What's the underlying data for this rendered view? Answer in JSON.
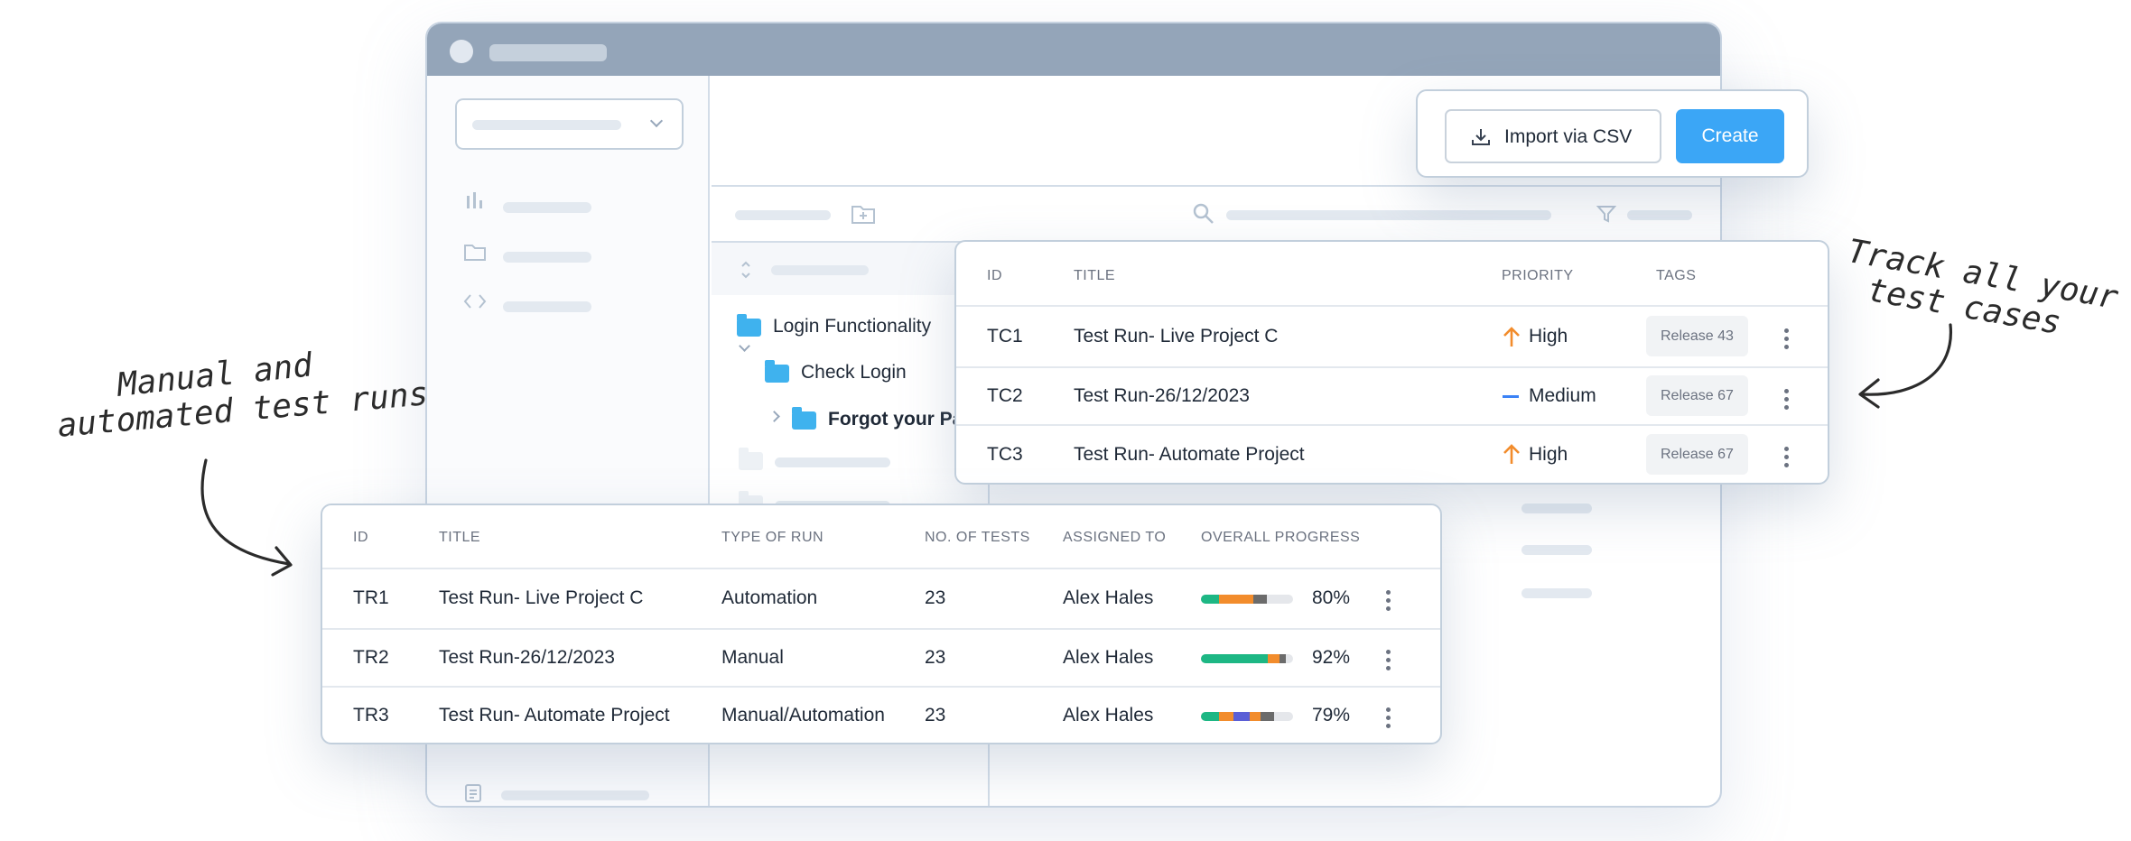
{
  "annotations": {
    "left_line1": "Manual and",
    "left_line2": "automated test runs",
    "right_line1": "Track all your",
    "right_line2": "test cases"
  },
  "folder_tree": {
    "items": [
      {
        "label": "Login Functionality",
        "icon": "folder-icon"
      },
      {
        "label": "Check Login",
        "icon": "folder-icon"
      },
      {
        "label": "Forgot your Pa",
        "icon": "folder-icon"
      }
    ]
  },
  "actions": {
    "import_label": "Import via CSV",
    "create_label": "Create"
  },
  "test_cases": {
    "headers": [
      "ID",
      "TITLE",
      "PRIORITY",
      "TAGS"
    ],
    "rows": [
      {
        "id": "TC1",
        "title": "Test Run- Live Project C",
        "priority": "High",
        "priority_icon": "arrow-up-icon",
        "tag": "Release 43"
      },
      {
        "id": "TC2",
        "title": "Test Run-26/12/2023",
        "priority": "Medium",
        "priority_icon": "minus-icon",
        "tag": "Release 67"
      },
      {
        "id": "TC3",
        "title": "Test Run- Automate Project",
        "priority": "High",
        "priority_icon": "arrow-up-icon",
        "tag": "Release 67"
      }
    ]
  },
  "test_runs": {
    "headers": [
      "ID",
      "TITLE",
      "TYPE OF RUN",
      "NO. OF TESTS",
      "ASSIGNED TO",
      "OVERALL PROGRESS"
    ],
    "rows": [
      {
        "id": "TR1",
        "title": "Test Run- Live Project C",
        "type": "Automation",
        "tests": "23",
        "assignee": "Alex Hales",
        "progress": "80%",
        "segments": [
          {
            "pct": 0.2,
            "color": "#1db784"
          },
          {
            "pct": 0.37,
            "color": "#f28c2c"
          },
          {
            "pct": 0.15,
            "color": "#6b6b6b"
          }
        ]
      },
      {
        "id": "TR2",
        "title": "Test Run-26/12/2023",
        "type": "Manual",
        "tests": "23",
        "assignee": "Alex Hales",
        "progress": "92%",
        "segments": [
          {
            "pct": 0.73,
            "color": "#1db784"
          },
          {
            "pct": 0.12,
            "color": "#f28c2c"
          },
          {
            "pct": 0.07,
            "color": "#6b6b6b"
          }
        ]
      },
      {
        "id": "TR3",
        "title": "Test Run- Automate Project",
        "type": "Manual/Automation",
        "tests": "23",
        "assignee": "Alex Hales",
        "progress": "79%",
        "segments": [
          {
            "pct": 0.2,
            "color": "#1db784"
          },
          {
            "pct": 0.15,
            "color": "#f28c2c"
          },
          {
            "pct": 0.18,
            "color": "#5b5fd6"
          },
          {
            "pct": 0.12,
            "color": "#f28c2c"
          },
          {
            "pct": 0.14,
            "color": "#6b6b6b"
          }
        ]
      }
    ]
  },
  "colors": {
    "primary": "#3ba6f6",
    "priority_high": "#f28c2c",
    "priority_medium": "#3b82f6",
    "folder": "#3fb2ee",
    "titlebar": "#94a5b9"
  }
}
